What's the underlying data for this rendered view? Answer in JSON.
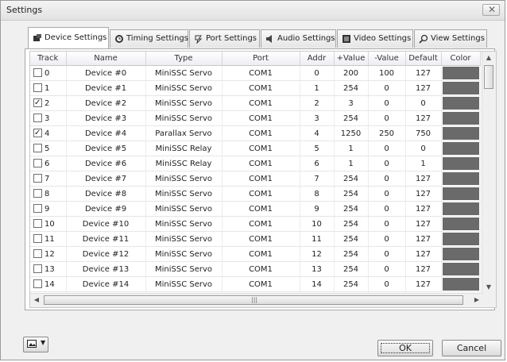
{
  "window": {
    "title": "Settings"
  },
  "tabs": [
    {
      "label": "Device Settings",
      "icon": "device-icon"
    },
    {
      "label": "Timing Settings",
      "icon": "timing-icon"
    },
    {
      "label": "Port Settings",
      "icon": "port-icon"
    },
    {
      "label": "Audio Settings",
      "icon": "audio-icon"
    },
    {
      "label": "Video Settings",
      "icon": "video-icon"
    },
    {
      "label": "View Settings",
      "icon": "view-icon"
    }
  ],
  "table": {
    "columns": [
      "Track",
      "Name",
      "Type",
      "Port",
      "Addr",
      "+Value",
      "-Value",
      "Default",
      "Color"
    ],
    "rows": [
      {
        "track": "0",
        "checked": false,
        "name": "Device #0",
        "type": "MiniSSC Servo",
        "port": "COM1",
        "addr": "0",
        "plus": "200",
        "minus": "100",
        "def": "127"
      },
      {
        "track": "1",
        "checked": false,
        "name": "Device #1",
        "type": "MiniSSC Servo",
        "port": "COM1",
        "addr": "1",
        "plus": "254",
        "minus": "0",
        "def": "127"
      },
      {
        "track": "2",
        "checked": true,
        "name": "Device #2",
        "type": "MiniSSC Servo",
        "port": "COM1",
        "addr": "2",
        "plus": "3",
        "minus": "0",
        "def": "0"
      },
      {
        "track": "3",
        "checked": false,
        "name": "Device #3",
        "type": "MiniSSC Servo",
        "port": "COM1",
        "addr": "3",
        "plus": "254",
        "minus": "0",
        "def": "127"
      },
      {
        "track": "4",
        "checked": true,
        "name": "Device #4",
        "type": "Parallax Servo",
        "port": "COM1",
        "addr": "4",
        "plus": "1250",
        "minus": "250",
        "def": "750"
      },
      {
        "track": "5",
        "checked": false,
        "name": "Device #5",
        "type": "MiniSSC Relay",
        "port": "COM1",
        "addr": "5",
        "plus": "1",
        "minus": "0",
        "def": "0"
      },
      {
        "track": "6",
        "checked": false,
        "name": "Device #6",
        "type": "MiniSSC Relay",
        "port": "COM1",
        "addr": "6",
        "plus": "1",
        "minus": "0",
        "def": "1"
      },
      {
        "track": "7",
        "checked": false,
        "name": "Device #7",
        "type": "MiniSSC Servo",
        "port": "COM1",
        "addr": "7",
        "plus": "254",
        "minus": "0",
        "def": "127"
      },
      {
        "track": "8",
        "checked": false,
        "name": "Device #8",
        "type": "MiniSSC Servo",
        "port": "COM1",
        "addr": "8",
        "plus": "254",
        "minus": "0",
        "def": "127"
      },
      {
        "track": "9",
        "checked": false,
        "name": "Device #9",
        "type": "MiniSSC Servo",
        "port": "COM1",
        "addr": "9",
        "plus": "254",
        "minus": "0",
        "def": "127"
      },
      {
        "track": "10",
        "checked": false,
        "name": "Device #10",
        "type": "MiniSSC Servo",
        "port": "COM1",
        "addr": "10",
        "plus": "254",
        "minus": "0",
        "def": "127"
      },
      {
        "track": "11",
        "checked": false,
        "name": "Device #11",
        "type": "MiniSSC Servo",
        "port": "COM1",
        "addr": "11",
        "plus": "254",
        "minus": "0",
        "def": "127"
      },
      {
        "track": "12",
        "checked": false,
        "name": "Device #12",
        "type": "MiniSSC Servo",
        "port": "COM1",
        "addr": "12",
        "plus": "254",
        "minus": "0",
        "def": "127"
      },
      {
        "track": "13",
        "checked": false,
        "name": "Device #13",
        "type": "MiniSSC Servo",
        "port": "COM1",
        "addr": "13",
        "plus": "254",
        "minus": "0",
        "def": "127"
      },
      {
        "track": "14",
        "checked": false,
        "name": "Device #14",
        "type": "MiniSSC Servo",
        "port": "COM1",
        "addr": "14",
        "plus": "254",
        "minus": "0",
        "def": "127"
      }
    ]
  },
  "buttons": {
    "ok": "OK",
    "cancel": "Cancel"
  },
  "colors": {
    "swatch": "#6a6a6a"
  }
}
